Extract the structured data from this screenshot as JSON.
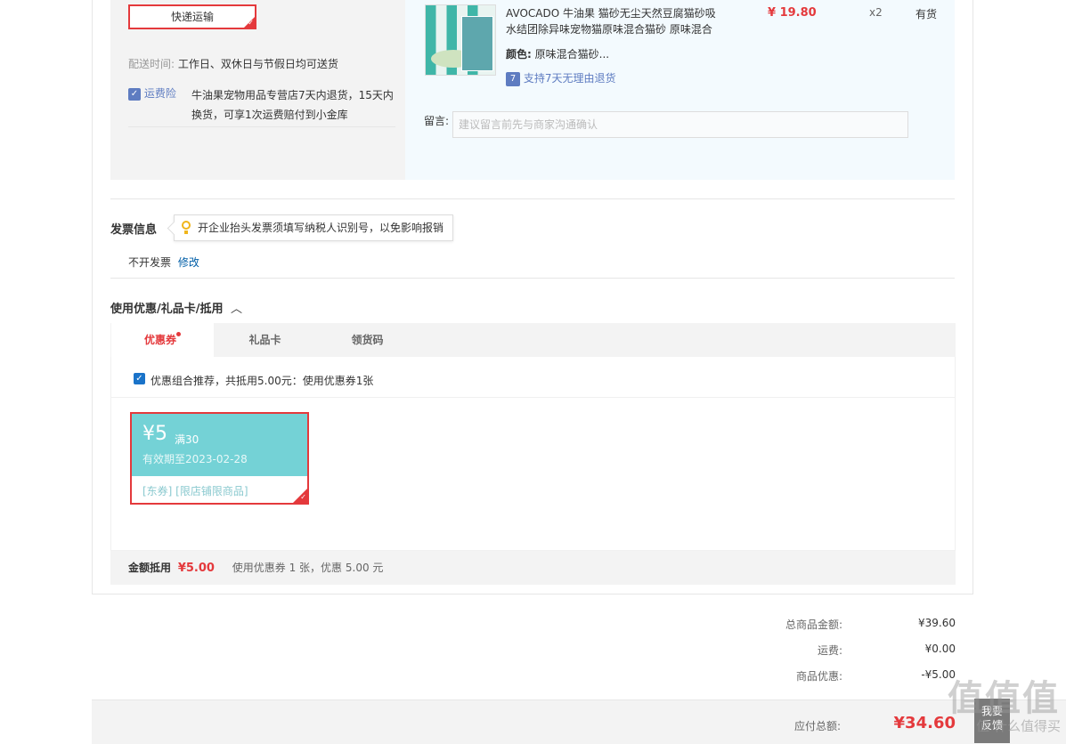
{
  "shipping": {
    "method_label": "快递运输",
    "delivery_time_label": "配送时间:",
    "delivery_time_value": "工作日、双休日与节假日均可送货",
    "insurance_label": "运费险",
    "insurance_desc_1": "牛油果宠物用品专营店7天内退货，15天内",
    "insurance_desc_2": "换货，可享1次运费赔付到小金库"
  },
  "item": {
    "title_1": "AVOCADO 牛油果 猫砂无尘天然豆腐猫砂吸",
    "title_2": "水结团除异味宠物猫原味混合猫砂 原味混合",
    "color_label": "颜色:",
    "color_value": "原味混合猫砂...",
    "return_policy": "支持7天无理由退货",
    "price": "¥ 19.80",
    "quantity": "x2",
    "stock": "有货",
    "note_label": "留言:",
    "note_placeholder": "建议留言前先与商家沟通确认"
  },
  "invoice": {
    "title": "发票信息",
    "tip": "开企业抬头发票须填写纳税人识别号，以免影响报销",
    "status": "不开发票",
    "edit": "修改"
  },
  "discount": {
    "title": "使用优惠/礼品卡/抵用",
    "tabs": [
      "优惠券",
      "礼品卡",
      "领货码"
    ],
    "recommend_text": "优惠组合推荐，共抵用5.00元：使用优惠券1张",
    "coupon": {
      "amount": "¥5",
      "condition": "满30",
      "expiry": "有效期至2023-02-28",
      "scope": "[东券] [限店铺限商品]"
    },
    "summary_label": "金额抵用",
    "summary_amount": "¥5.00",
    "summary_desc": "使用优惠券 1 张，优惠 5.00 元"
  },
  "totals": {
    "goods_label": "总商品金额:",
    "goods_value": "¥39.60",
    "shipping_label": "运费:",
    "shipping_value": "¥0.00",
    "discount_label": "商品优惠:",
    "discount_value": "-¥5.00",
    "pay_label": "应付总额:",
    "pay_value": "¥34.60"
  },
  "side_widget": {
    "label_1": "我要",
    "label_2": "反馈"
  },
  "watermark": "值 什么值得买",
  "colors": {
    "accent_red": "#e4393c",
    "coupon_teal": "#74d2d6",
    "link_blue": "#005ea7"
  }
}
